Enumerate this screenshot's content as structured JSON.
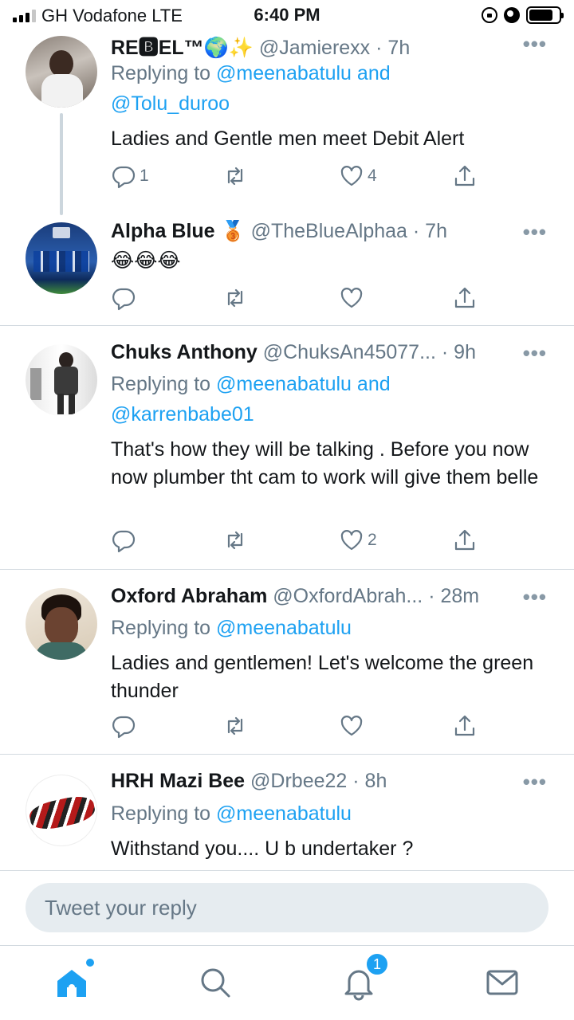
{
  "status_bar": {
    "carrier": "GH Vodafone  LTE",
    "time": "6:40 PM"
  },
  "tweets": [
    {
      "name": "RE🅱EL™🌍✨",
      "handle": "@Jamierexx",
      "time": "· 7h",
      "replying_prefix": "Replying to ",
      "replying_mentions": "@meenabatulu and",
      "replying_mentions_2": "@Tolu_duroo",
      "text": "Ladies and Gentle men meet Debit Alert",
      "reply_count": "1",
      "retweet_count": "",
      "like_count": "4"
    },
    {
      "name": "Alpha Blue 🥉",
      "handle": "@TheBlueAlphaa",
      "time": "· 7h",
      "text": "😂😂😂",
      "reply_count": "",
      "retweet_count": "",
      "like_count": ""
    },
    {
      "name": "Chuks Anthony",
      "handle": "@ChuksAn45077...",
      "time": "· 9h",
      "replying_prefix": "Replying to ",
      "replying_mentions": "@meenabatulu and",
      "replying_mentions_2": "@karrenbabe01",
      "text": "That's how they will be talking . Before you now now plumber tht cam to work will give them belle",
      "reply_count": "",
      "retweet_count": "",
      "like_count": "2"
    },
    {
      "name": "Oxford Abraham",
      "handle": "@OxfordAbrah...",
      "time": "· 28m",
      "replying_prefix": "Replying to ",
      "replying_mentions": "@meenabatulu",
      "text": "Ladies and gentlemen! Let's welcome the green thunder",
      "reply_count": "",
      "retweet_count": "",
      "like_count": ""
    },
    {
      "name": "HRH Mazi Bee",
      "handle": "@Drbee22",
      "time": "· 8h",
      "replying_prefix": "Replying to ",
      "replying_mentions": "@meenabatulu",
      "text": "Withstand you.... U b undertaker ?"
    }
  ],
  "more_icon": "•••",
  "reply_box": {
    "placeholder": "Tweet your reply"
  },
  "tab_bar": {
    "notifications_badge": "1"
  },
  "colors": {
    "accent": "#1da1f2",
    "muted": "#657786",
    "divider": "#d3dae0"
  }
}
